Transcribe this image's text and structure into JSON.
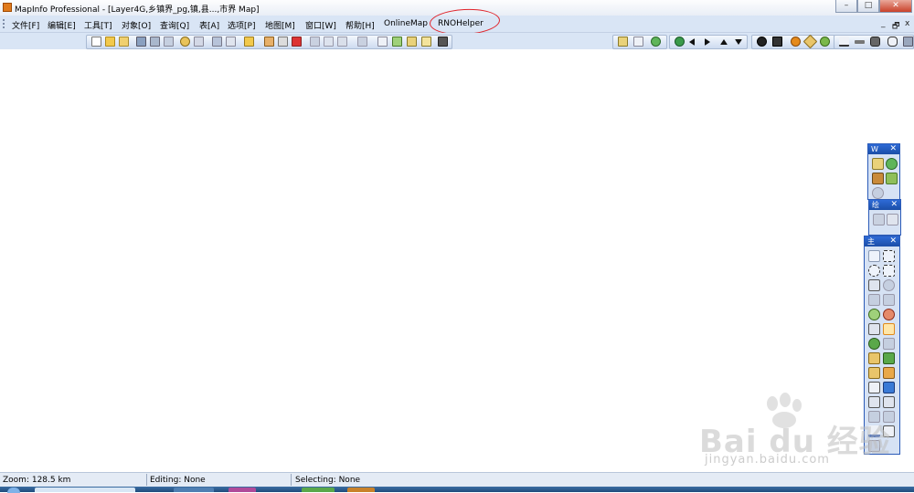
{
  "window": {
    "title": "MapInfo Professional - [Layer4G,乡镇界_pg,镇,县...,市界 Map]",
    "controls": {
      "minimize": "–",
      "maximize": "□",
      "close": "✕"
    }
  },
  "menubar": {
    "items": [
      {
        "label": "文件[F]"
      },
      {
        "label": "编辑[E]"
      },
      {
        "label": "工具[T]"
      },
      {
        "label": "对象[O]"
      },
      {
        "label": "查询[Q]"
      },
      {
        "label": "表[A]"
      },
      {
        "label": "选项[P]"
      },
      {
        "label": "地图[M]"
      },
      {
        "label": "窗口[W]"
      },
      {
        "label": "帮助[H]"
      },
      {
        "label": "OnlineMap"
      },
      {
        "label": "RNOHelper",
        "annotation": "circled-red"
      }
    ],
    "mdi_controls": {
      "minimize": "_",
      "restore": "🗗",
      "close": "x"
    }
  },
  "toolbars": {
    "standard": [
      "new-icon",
      "open-icon",
      "open-workspace-icon",
      "save-icon",
      "save-copy-icon",
      "copy-map-icon",
      "find-icon",
      "find-selection-icon",
      "close-table-icon",
      "print-icon",
      "new-browser-icon",
      "new-map-icon",
      "new-graph-icon",
      "new-layout-icon",
      "cut-icon",
      "copy-icon",
      "paste-icon",
      "undo-icon",
      "browser-icon",
      "map-icon",
      "graph-icon",
      "layout-icon",
      "redistrict-icon"
    ],
    "right_group_1": [
      "layer-control-icon",
      "info-icon",
      "globe-icon"
    ],
    "right_group_2": [
      "globe-nav-icon",
      "arrow-left-icon",
      "arrow-right-icon",
      "arrow-up-icon",
      "arrow-down-icon"
    ],
    "right_group_3": [
      "radiation-icon",
      "film-icon",
      "orange-circle-icon",
      "tag-icon",
      "info-green-icon"
    ],
    "right_group_4": [
      "chart-line-icon",
      "ruler-icon",
      "car-icon",
      "drum-icon",
      "grip-icon"
    ]
  },
  "palettes": {
    "tools": {
      "title": "W",
      "close": "✕"
    },
    "drawing": {
      "title": "绘",
      "close": "✕"
    },
    "main": {
      "title": "主",
      "close": "✕",
      "buttons": [
        "select-icon",
        "marquee-select-icon",
        "radius-select-icon",
        "polygon-select-icon",
        "boundary-select-icon",
        "invert-select-icon",
        "graph-select-icon",
        "unselect-icon",
        "zoom-in-icon",
        "zoom-out-icon",
        "info-tool-icon",
        "grabber-hand-icon",
        "label-icon",
        "hotlink-icon",
        "drag-window-icon",
        "ruler-tool-icon",
        "layer-control-icon",
        "legend-icon",
        "statistics-icon",
        "thematic-icon",
        "clip-icon",
        "add-node-icon",
        "show-hide-icon",
        "legend-frame-icon",
        "scale-bar-icon",
        "cosmetic-icon"
      ]
    }
  },
  "statusbar": {
    "zoom": "Zoom: 128.5 km",
    "editing": "Editing: None",
    "selecting": "Selecting: None"
  },
  "watermark": {
    "brand": "Bai du 经验",
    "url": "jingyan.baidu.com"
  },
  "colors": {
    "menubar_bg": "#d9e5f5",
    "palette_header": "#2e6ad6",
    "annotation_red": "#e0242b",
    "app_orange": "#e07a1c"
  }
}
